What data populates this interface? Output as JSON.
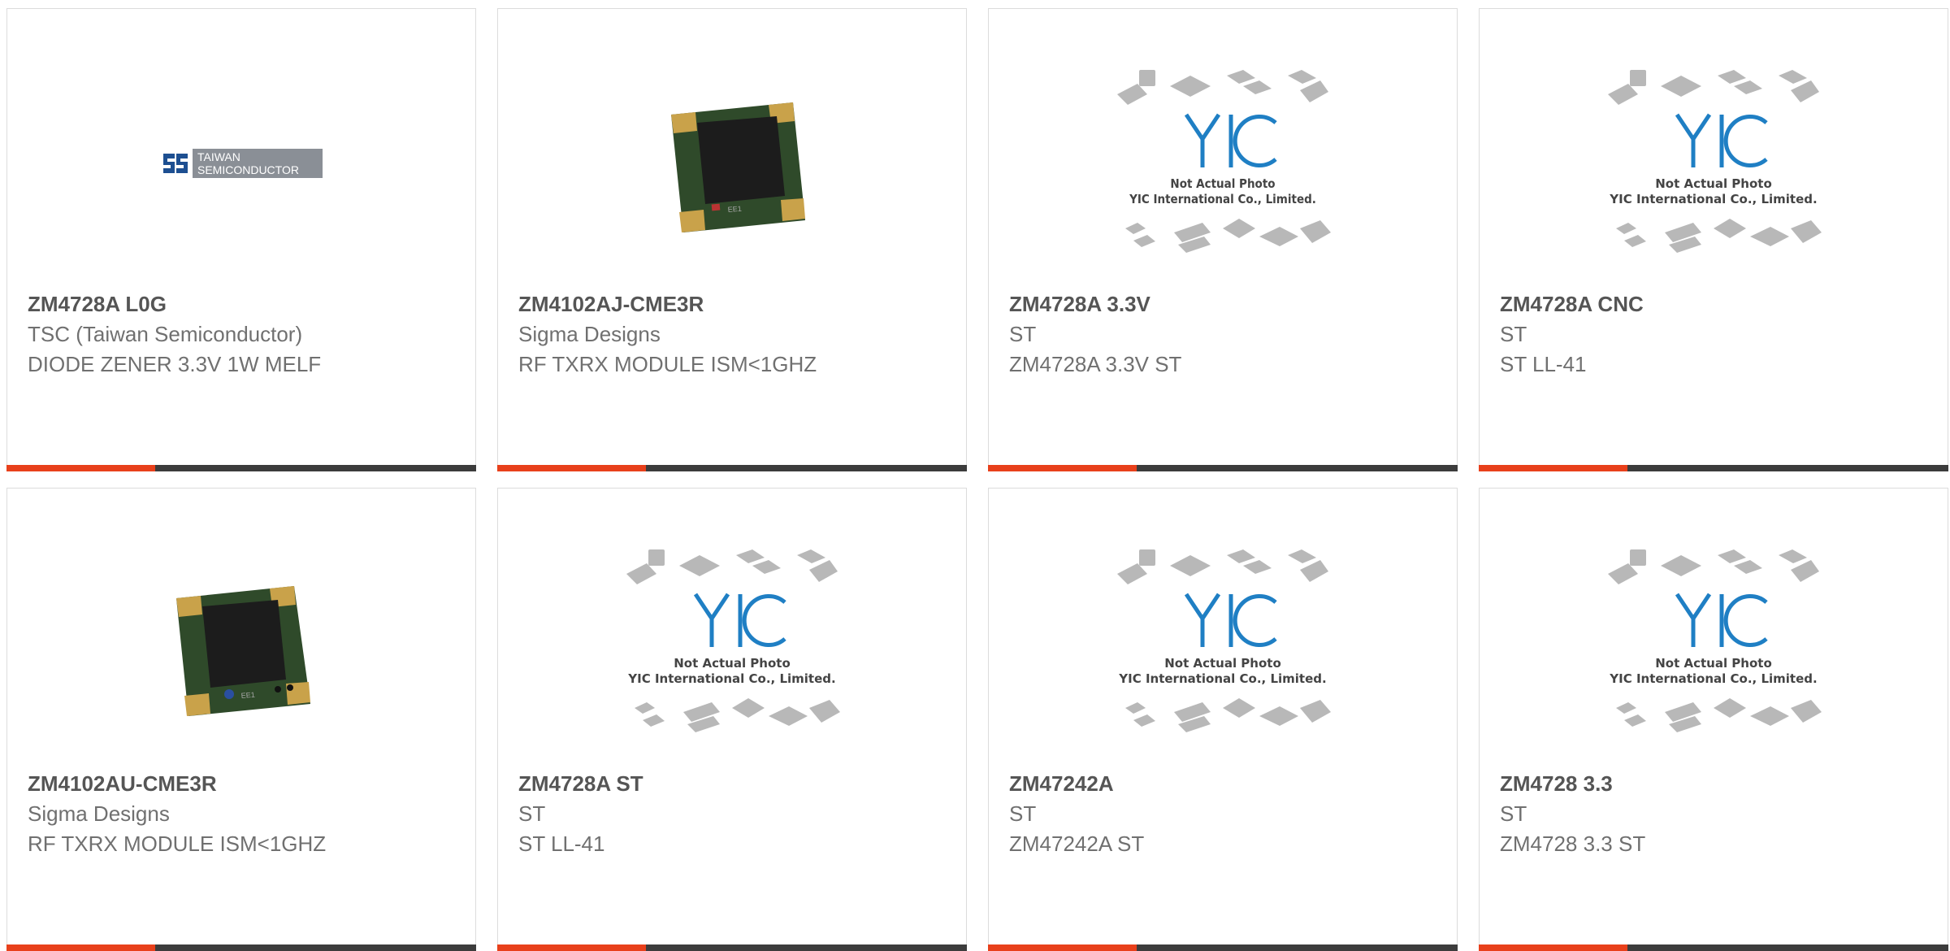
{
  "products": [
    {
      "part_number": "ZM4728A L0G",
      "manufacturer": "TSC (Taiwan Semiconductor)",
      "description": "DIODE ZENER 3.3V 1W MELF",
      "image": "taiwan-semiconductor-logo",
      "logo_text_1": "TAIWAN",
      "logo_text_2": "SEMICONDUCTOR"
    },
    {
      "part_number": "ZM4102AJ-CME3R",
      "manufacturer": "Sigma Designs",
      "description": "RF TXRX MODULE ISM<1GHZ",
      "image": "rf-module-photo"
    },
    {
      "part_number": "ZM4728A 3.3V",
      "manufacturer": "ST",
      "description": "ZM4728A 3.3V ST",
      "image": "yic-placeholder",
      "placeholder_line_1": "Not Actual Photo",
      "placeholder_line_2": "YIC International Co., Limited."
    },
    {
      "part_number": "ZM4728A CNC",
      "manufacturer": "ST",
      "description": "ST LL-41",
      "image": "yic-placeholder",
      "placeholder_line_1": "Not Actual Photo",
      "placeholder_line_2": "YIC International Co., Limited."
    },
    {
      "part_number": "ZM4102AU-CME3R",
      "manufacturer": "Sigma Designs",
      "description": "RF TXRX MODULE ISM<1GHZ",
      "image": "rf-module-photo"
    },
    {
      "part_number": "ZM4728A ST",
      "manufacturer": "ST",
      "description": "ST LL-41",
      "image": "yic-placeholder",
      "placeholder_line_1": "Not Actual Photo",
      "placeholder_line_2": "YIC International Co., Limited."
    },
    {
      "part_number": "ZM47242A",
      "manufacturer": "ST",
      "description": "ZM47242A ST",
      "image": "yic-placeholder",
      "placeholder_line_1": "Not Actual Photo",
      "placeholder_line_2": "YIC International Co., Limited."
    },
    {
      "part_number": "ZM4728 3.3",
      "manufacturer": "ST",
      "description": "ZM4728 3.3 ST",
      "image": "yic-placeholder",
      "placeholder_line_1": "Not Actual Photo",
      "placeholder_line_2": "YIC International Co., Limited."
    }
  ],
  "colors": {
    "accent": "#e8401b",
    "bar": "#3c3c3c",
    "yic_blue": "#1f7fc4",
    "tsc_blue": "#1d4f91",
    "logo_gray": "#8a8f96",
    "module_green": "#2f4a2a",
    "module_gold": "#c9a24a"
  }
}
